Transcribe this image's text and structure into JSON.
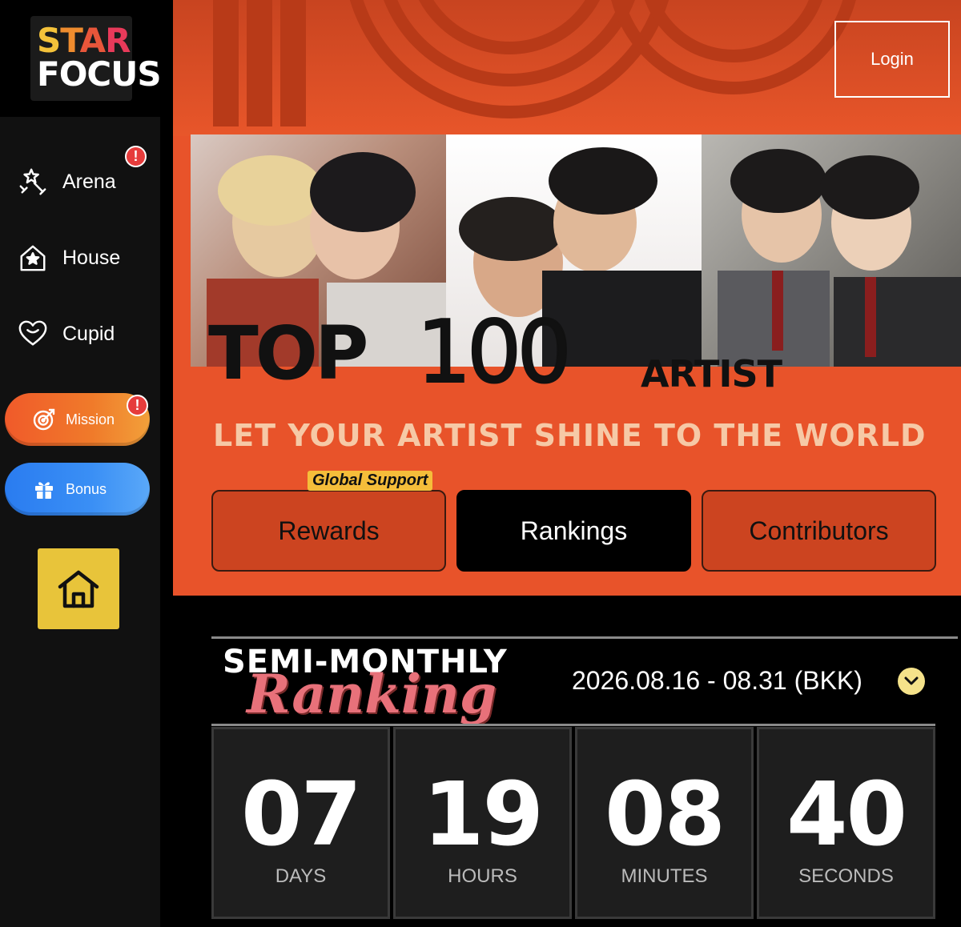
{
  "logo": {
    "line1": [
      "S",
      "T",
      "A",
      "R"
    ],
    "line2": "FOCUS"
  },
  "sidebar": {
    "items": [
      {
        "label": "Arena",
        "icon": "arena-icon",
        "alert": "!"
      },
      {
        "label": "House",
        "icon": "house-icon"
      },
      {
        "label": "Cupid",
        "icon": "cupid-heart-icon"
      }
    ],
    "mission": {
      "label": "Mission",
      "icon": "target-icon",
      "alert": "!"
    },
    "bonus": {
      "label": "Bonus",
      "icon": "gift-icon"
    },
    "home": {
      "icon": "home-icon"
    }
  },
  "header": {
    "login_label": "Login"
  },
  "banner": {
    "title_top": "TOP",
    "title_num": "100",
    "title_artist": "ARTIST",
    "tagline": "LET YOUR ARTIST SHINE TO THE WORLD",
    "badge": "Global Support"
  },
  "tabs": [
    {
      "label": "Rewards"
    },
    {
      "label": "Rankings",
      "active": true
    },
    {
      "label": "Contributors"
    }
  ],
  "ranking": {
    "heading_line1": "SEMI-MONTHLY",
    "heading_line2": "Ranking",
    "date_range": "2026.08.16 - 08.31 (BKK)",
    "countdown": [
      {
        "value": "07",
        "unit": "DAYS"
      },
      {
        "value": "19",
        "unit": "HOURS"
      },
      {
        "value": "08",
        "unit": "MINUTES"
      },
      {
        "value": "40",
        "unit": "SECONDS"
      }
    ]
  },
  "colors": {
    "accent_orange": "#e8532a",
    "tab_orange": "#cc4420",
    "home_yellow": "#e8c43a",
    "ranking_pink": "#e8717a",
    "alert_red": "#e63c3c"
  }
}
